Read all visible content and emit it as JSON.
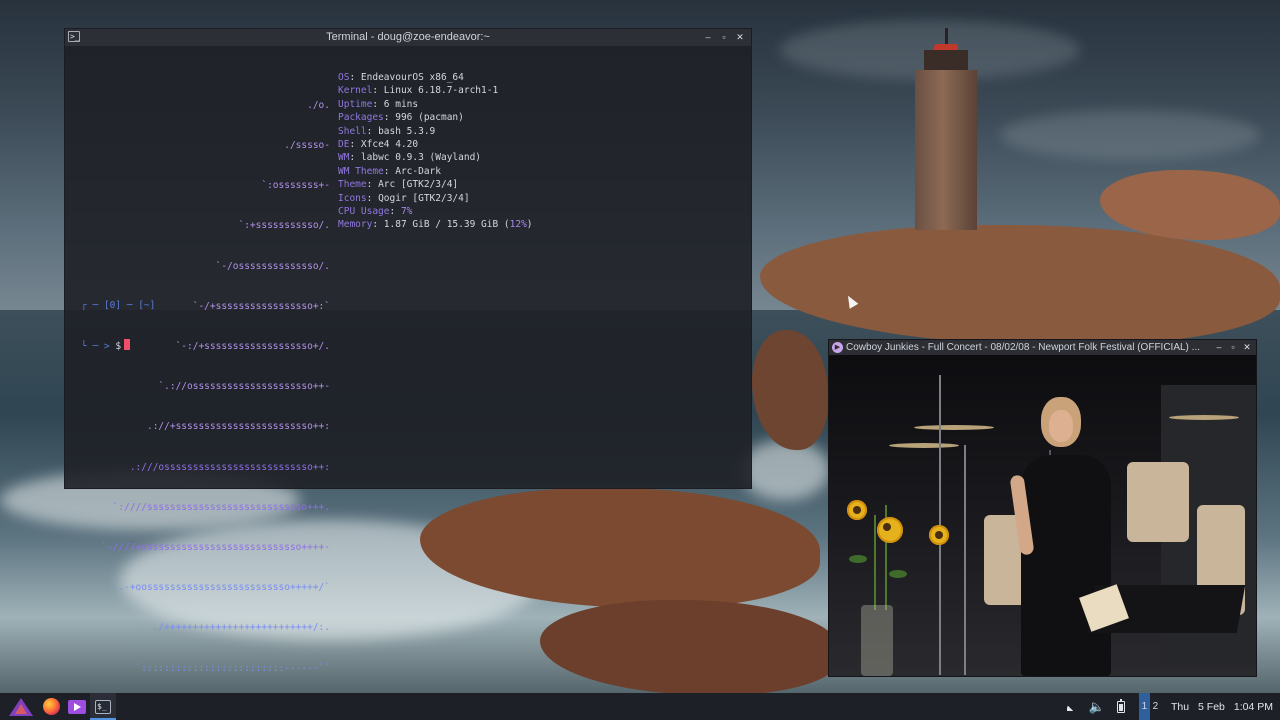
{
  "terminal": {
    "title": "Terminal - doug@zoe-endeavor:~",
    "buttons": {
      "minimize": "–",
      "maximize": "▫",
      "close": "✕"
    },
    "logo_lines": [
      "./o.",
      "./sssso-",
      "`:osssssss+-",
      "`:+sssssssssso/.",
      "`-/ossssssssssssso/.",
      "`-/+sssssssssssssssso+:`",
      "`-:/+sssssssssssssssssso+/.",
      "`.://osssssssssssssssssssso++-",
      ".://+ssssssssssssssssssssssso++:",
      ".:///ossssssssssssssssssssssssso++:",
      "`:////ssssssssssssssssssssssssssso+++.",
      "`-////+ssssssssssssssssssssssssssso++++-",
      "`..-+oosssssssssssssssssssssssso+++++/`",
      "./++++++++++++++++++++++++++/:.",
      "`:::::::::::::::::::::::::------``"
    ],
    "info": [
      {
        "key": "OS",
        "value": "EndeavourOS x86_64"
      },
      {
        "key": "Kernel",
        "value": "Linux 6.18.7-arch1-1"
      },
      {
        "key": "Uptime",
        "value": "6 mins"
      },
      {
        "key": "Packages",
        "value": "996 (pacman)"
      },
      {
        "key": "Shell",
        "value": "bash 5.3.9"
      },
      {
        "key": "DE",
        "value": "Xfce4 4.20"
      },
      {
        "key": "WM",
        "value": "labwc 0.9.3 (Wayland)"
      },
      {
        "key": "WM Theme",
        "value": "Arc-Dark"
      },
      {
        "key": "Theme",
        "value": "Arc [GTK2/3/4]"
      },
      {
        "key": "Icons",
        "value": "Qogir [GTK2/3/4]"
      },
      {
        "key": "CPU Usage",
        "value": "7%"
      },
      {
        "key": "Memory",
        "value": "1.87 GiB / 15.39 GiB (",
        "extra": "12%",
        "tail": ")"
      }
    ],
    "prompt_line1": "┌ ─ [0] ─ [~]",
    "prompt_line2_prefix": "└ ─ > ",
    "prompt_symbol": "$"
  },
  "video": {
    "title": "Cowboy Junkies - Full Concert - 08/02/08 - Newport Folk Festival (OFFICIAL) ...",
    "buttons": {
      "minimize": "–",
      "maximize": "▫",
      "close": "✕"
    }
  },
  "taskbar": {
    "launchers": [
      "endeavouros-menu",
      "firefox",
      "media-player",
      "terminal"
    ],
    "workspaces": [
      "1",
      "2"
    ],
    "active_workspace": "1",
    "clock": {
      "day": "Thu",
      "date": "5 Feb",
      "time": "1:04 PM"
    },
    "tray": [
      "network-icon",
      "volume-icon",
      "battery-icon"
    ]
  },
  "colors": {
    "terminal_bg": "#1e2026",
    "logo_purple": "#b391ea",
    "info_key": "#9077e0",
    "cursor": "#ef4f6a",
    "taskbar_bg": "#1e2027",
    "workspace_active": "#2f5f9c"
  }
}
